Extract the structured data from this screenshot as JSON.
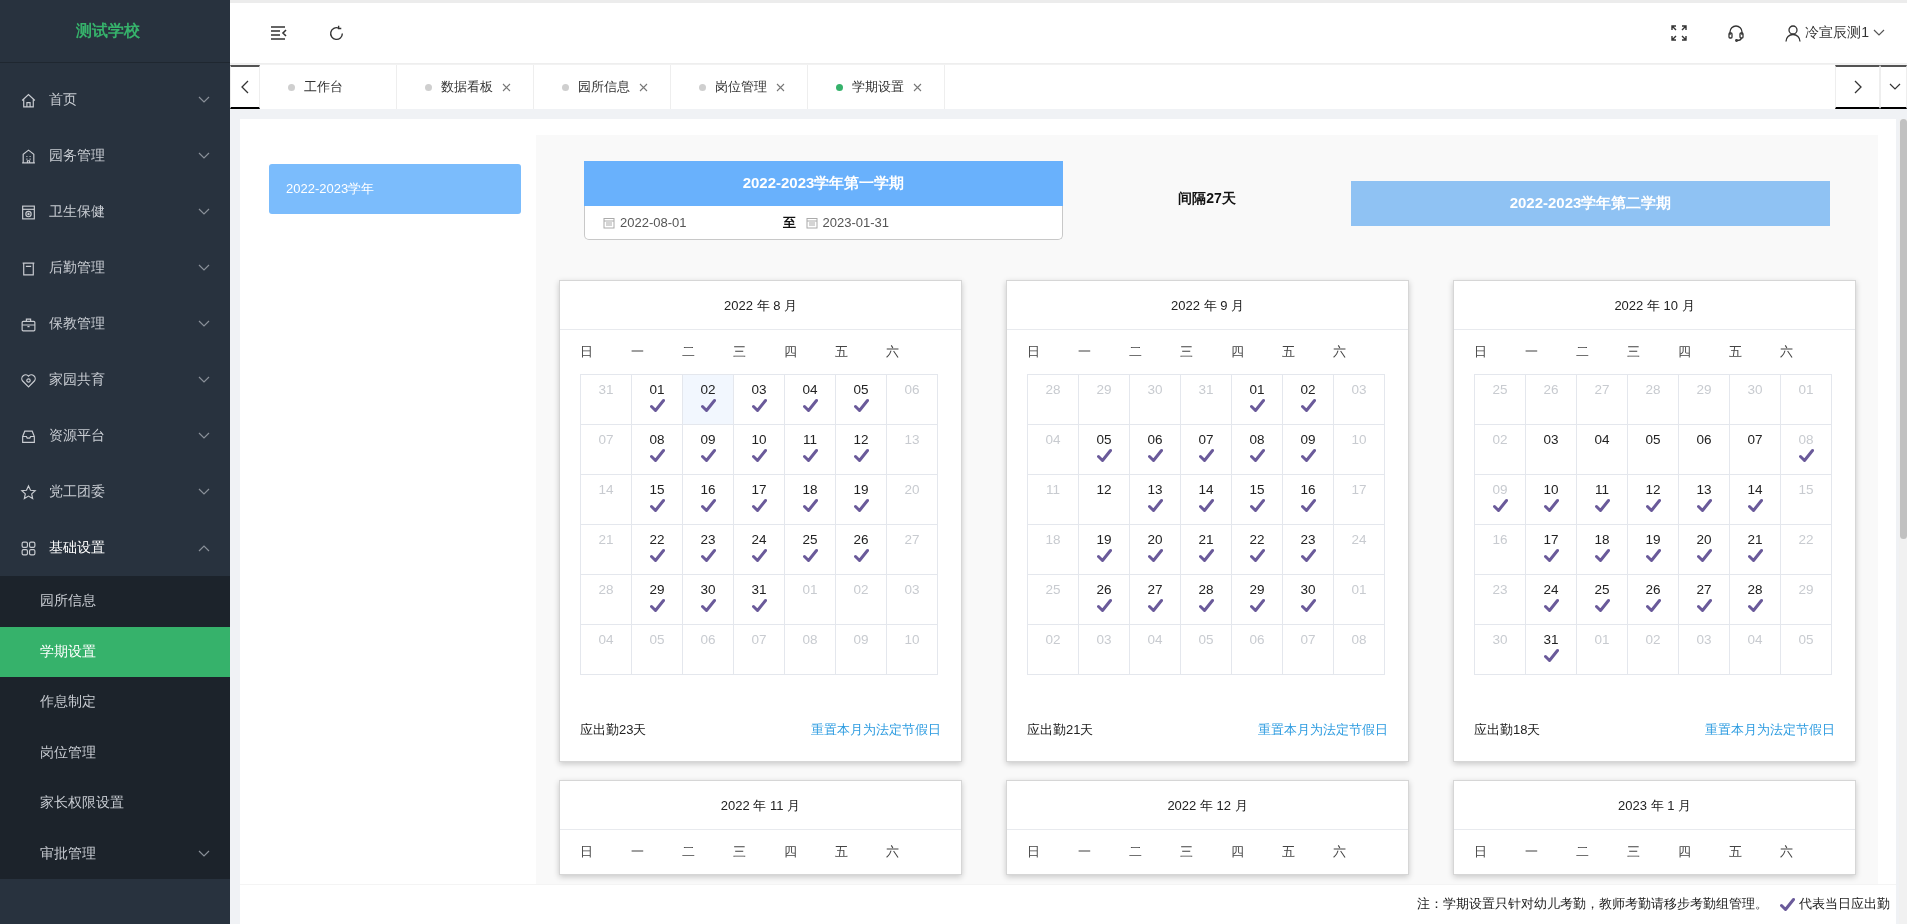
{
  "sidebar": {
    "logo": "测试学校",
    "items": [
      {
        "label": "首页",
        "expanded": false
      },
      {
        "label": "园务管理",
        "expanded": false
      },
      {
        "label": "卫生保健",
        "expanded": false
      },
      {
        "label": "后勤管理",
        "expanded": false
      },
      {
        "label": "保教管理",
        "expanded": false
      },
      {
        "label": "家园共育",
        "expanded": false
      },
      {
        "label": "资源平台",
        "expanded": false
      },
      {
        "label": "党工团委",
        "expanded": false
      },
      {
        "label": "基础设置",
        "expanded": true,
        "children": [
          {
            "label": "园所信息",
            "kind": "item",
            "selected": false
          },
          {
            "label": "学期设置",
            "kind": "item",
            "selected": true
          },
          {
            "label": "作息制定",
            "kind": "item",
            "selected": false
          },
          {
            "label": "岗位管理",
            "kind": "item",
            "selected": false
          },
          {
            "label": "家长权限设置",
            "kind": "item",
            "selected": false
          },
          {
            "label": "审批管理",
            "kind": "submenu",
            "selected": false
          }
        ]
      }
    ]
  },
  "header": {
    "user": "冷宣辰测1"
  },
  "tabs": [
    {
      "label": "工作台",
      "selected": false,
      "closable": false
    },
    {
      "label": "数据看板",
      "selected": false,
      "closable": true
    },
    {
      "label": "园所信息",
      "selected": false,
      "closable": true
    },
    {
      "label": "岗位管理",
      "selected": false,
      "closable": true
    },
    {
      "label": "学期设置",
      "selected": true,
      "closable": true
    }
  ],
  "years": [
    {
      "label": "2022-2023学年",
      "selected": true
    }
  ],
  "terms": [
    {
      "title": "2022-2023学年第一学期",
      "selected": true,
      "start": "2022-08-01",
      "separator": "至",
      "end": "2023-01-31"
    },
    {
      "title": "2022-2023学年第二学期",
      "selected": false
    }
  ],
  "interval": "间隔27天",
  "months": [
    {
      "title": "2022 年 8 月",
      "weekdays": [
        "日",
        "一",
        "二",
        "三",
        "四",
        "五",
        "六"
      ],
      "summary": "应出勤23天",
      "reset_link": "重置本月为法定节假日",
      "weeks": [
        [
          {
            "day": "31",
            "muted": true,
            "checked": false,
            "highlighted": false
          },
          {
            "day": "01",
            "muted": false,
            "checked": true,
            "highlighted": false
          },
          {
            "day": "02",
            "muted": false,
            "checked": true,
            "highlighted": true
          },
          {
            "day": "03",
            "muted": false,
            "checked": true,
            "highlighted": false
          },
          {
            "day": "04",
            "muted": false,
            "checked": true,
            "highlighted": false
          },
          {
            "day": "05",
            "muted": false,
            "checked": true,
            "highlighted": false
          },
          {
            "day": "06",
            "muted": true,
            "checked": false,
            "highlighted": false
          }
        ],
        [
          {
            "day": "07",
            "muted": true,
            "checked": false,
            "highlighted": false
          },
          {
            "day": "08",
            "muted": false,
            "checked": true,
            "highlighted": false
          },
          {
            "day": "09",
            "muted": false,
            "checked": true,
            "highlighted": false
          },
          {
            "day": "10",
            "muted": false,
            "checked": true,
            "highlighted": false
          },
          {
            "day": "11",
            "muted": false,
            "checked": true,
            "highlighted": false
          },
          {
            "day": "12",
            "muted": false,
            "checked": true,
            "highlighted": false
          },
          {
            "day": "13",
            "muted": true,
            "checked": false,
            "highlighted": false
          }
        ],
        [
          {
            "day": "14",
            "muted": true,
            "checked": false,
            "highlighted": false
          },
          {
            "day": "15",
            "muted": false,
            "checked": true,
            "highlighted": false
          },
          {
            "day": "16",
            "muted": false,
            "checked": true,
            "highlighted": false
          },
          {
            "day": "17",
            "muted": false,
            "checked": true,
            "highlighted": false
          },
          {
            "day": "18",
            "muted": false,
            "checked": true,
            "highlighted": false
          },
          {
            "day": "19",
            "muted": false,
            "checked": true,
            "highlighted": false
          },
          {
            "day": "20",
            "muted": true,
            "checked": false,
            "highlighted": false
          }
        ],
        [
          {
            "day": "21",
            "muted": true,
            "checked": false,
            "highlighted": false
          },
          {
            "day": "22",
            "muted": false,
            "checked": true,
            "highlighted": false
          },
          {
            "day": "23",
            "muted": false,
            "checked": true,
            "highlighted": false
          },
          {
            "day": "24",
            "muted": false,
            "checked": true,
            "highlighted": false
          },
          {
            "day": "25",
            "muted": false,
            "checked": true,
            "highlighted": false
          },
          {
            "day": "26",
            "muted": false,
            "checked": true,
            "highlighted": false
          },
          {
            "day": "27",
            "muted": true,
            "checked": false,
            "highlighted": false
          }
        ],
        [
          {
            "day": "28",
            "muted": true,
            "checked": false,
            "highlighted": false
          },
          {
            "day": "29",
            "muted": false,
            "checked": true,
            "highlighted": false
          },
          {
            "day": "30",
            "muted": false,
            "checked": true,
            "highlighted": false
          },
          {
            "day": "31",
            "muted": false,
            "checked": true,
            "highlighted": false
          },
          {
            "day": "01",
            "muted": true,
            "checked": false,
            "highlighted": false
          },
          {
            "day": "02",
            "muted": true,
            "checked": false,
            "highlighted": false
          },
          {
            "day": "03",
            "muted": true,
            "checked": false,
            "highlighted": false
          }
        ],
        [
          {
            "day": "04",
            "muted": true,
            "checked": false,
            "highlighted": false
          },
          {
            "day": "05",
            "muted": true,
            "checked": false,
            "highlighted": false
          },
          {
            "day": "06",
            "muted": true,
            "checked": false,
            "highlighted": false
          },
          {
            "day": "07",
            "muted": true,
            "checked": false,
            "highlighted": false
          },
          {
            "day": "08",
            "muted": true,
            "checked": false,
            "highlighted": false
          },
          {
            "day": "09",
            "muted": true,
            "checked": false,
            "highlighted": false
          },
          {
            "day": "10",
            "muted": true,
            "checked": false,
            "highlighted": false
          }
        ]
      ]
    },
    {
      "title": "2022 年 9 月",
      "weekdays": [
        "日",
        "一",
        "二",
        "三",
        "四",
        "五",
        "六"
      ],
      "summary": "应出勤21天",
      "reset_link": "重置本月为法定节假日",
      "weeks": [
        [
          {
            "day": "28",
            "muted": true,
            "checked": false,
            "highlighted": false
          },
          {
            "day": "29",
            "muted": true,
            "checked": false,
            "highlighted": false
          },
          {
            "day": "30",
            "muted": true,
            "checked": false,
            "highlighted": false
          },
          {
            "day": "31",
            "muted": true,
            "checked": false,
            "highlighted": false
          },
          {
            "day": "01",
            "muted": false,
            "checked": true,
            "highlighted": false
          },
          {
            "day": "02",
            "muted": false,
            "checked": true,
            "highlighted": false
          },
          {
            "day": "03",
            "muted": true,
            "checked": false,
            "highlighted": false
          }
        ],
        [
          {
            "day": "04",
            "muted": true,
            "checked": false,
            "highlighted": false
          },
          {
            "day": "05",
            "muted": false,
            "checked": true,
            "highlighted": false
          },
          {
            "day": "06",
            "muted": false,
            "checked": true,
            "highlighted": false
          },
          {
            "day": "07",
            "muted": false,
            "checked": true,
            "highlighted": false
          },
          {
            "day": "08",
            "muted": false,
            "checked": true,
            "highlighted": false
          },
          {
            "day": "09",
            "muted": false,
            "checked": true,
            "highlighted": false
          },
          {
            "day": "10",
            "muted": true,
            "checked": false,
            "highlighted": false
          }
        ],
        [
          {
            "day": "11",
            "muted": true,
            "checked": false,
            "highlighted": false
          },
          {
            "day": "12",
            "muted": false,
            "checked": false,
            "highlighted": false
          },
          {
            "day": "13",
            "muted": false,
            "checked": true,
            "highlighted": false
          },
          {
            "day": "14",
            "muted": false,
            "checked": true,
            "highlighted": false
          },
          {
            "day": "15",
            "muted": false,
            "checked": true,
            "highlighted": false
          },
          {
            "day": "16",
            "muted": false,
            "checked": true,
            "highlighted": false
          },
          {
            "day": "17",
            "muted": true,
            "checked": false,
            "highlighted": false
          }
        ],
        [
          {
            "day": "18",
            "muted": true,
            "checked": false,
            "highlighted": false
          },
          {
            "day": "19",
            "muted": false,
            "checked": true,
            "highlighted": false
          },
          {
            "day": "20",
            "muted": false,
            "checked": true,
            "highlighted": false
          },
          {
            "day": "21",
            "muted": false,
            "checked": true,
            "highlighted": false
          },
          {
            "day": "22",
            "muted": false,
            "checked": true,
            "highlighted": false
          },
          {
            "day": "23",
            "muted": false,
            "checked": true,
            "highlighted": false
          },
          {
            "day": "24",
            "muted": true,
            "checked": false,
            "highlighted": false
          }
        ],
        [
          {
            "day": "25",
            "muted": true,
            "checked": false,
            "highlighted": false
          },
          {
            "day": "26",
            "muted": false,
            "checked": true,
            "highlighted": false
          },
          {
            "day": "27",
            "muted": false,
            "checked": true,
            "highlighted": false
          },
          {
            "day": "28",
            "muted": false,
            "checked": true,
            "highlighted": false
          },
          {
            "day": "29",
            "muted": false,
            "checked": true,
            "highlighted": false
          },
          {
            "day": "30",
            "muted": false,
            "checked": true,
            "highlighted": false
          },
          {
            "day": "01",
            "muted": true,
            "checked": false,
            "highlighted": false
          }
        ],
        [
          {
            "day": "02",
            "muted": true,
            "checked": false,
            "highlighted": false
          },
          {
            "day": "03",
            "muted": true,
            "checked": false,
            "highlighted": false
          },
          {
            "day": "04",
            "muted": true,
            "checked": false,
            "highlighted": false
          },
          {
            "day": "05",
            "muted": true,
            "checked": false,
            "highlighted": false
          },
          {
            "day": "06",
            "muted": true,
            "checked": false,
            "highlighted": false
          },
          {
            "day": "07",
            "muted": true,
            "checked": false,
            "highlighted": false
          },
          {
            "day": "08",
            "muted": true,
            "checked": false,
            "highlighted": false
          }
        ]
      ]
    },
    {
      "title": "2022 年 10 月",
      "weekdays": [
        "日",
        "一",
        "二",
        "三",
        "四",
        "五",
        "六"
      ],
      "summary": "应出勤18天",
      "reset_link": "重置本月为法定节假日",
      "weeks": [
        [
          {
            "day": "25",
            "muted": true,
            "checked": false,
            "highlighted": false
          },
          {
            "day": "26",
            "muted": true,
            "checked": false,
            "highlighted": false
          },
          {
            "day": "27",
            "muted": true,
            "checked": false,
            "highlighted": false
          },
          {
            "day": "28",
            "muted": true,
            "checked": false,
            "highlighted": false
          },
          {
            "day": "29",
            "muted": true,
            "checked": false,
            "highlighted": false
          },
          {
            "day": "30",
            "muted": true,
            "checked": false,
            "highlighted": false
          },
          {
            "day": "01",
            "muted": true,
            "checked": false,
            "highlighted": false
          }
        ],
        [
          {
            "day": "02",
            "muted": true,
            "checked": false,
            "highlighted": false
          },
          {
            "day": "03",
            "muted": false,
            "checked": false,
            "highlighted": false
          },
          {
            "day": "04",
            "muted": false,
            "checked": false,
            "highlighted": false
          },
          {
            "day": "05",
            "muted": false,
            "checked": false,
            "highlighted": false
          },
          {
            "day": "06",
            "muted": false,
            "checked": false,
            "highlighted": false
          },
          {
            "day": "07",
            "muted": false,
            "checked": false,
            "highlighted": false
          },
          {
            "day": "08",
            "muted": true,
            "checked": true,
            "highlighted": false
          }
        ],
        [
          {
            "day": "09",
            "muted": true,
            "checked": true,
            "highlighted": false
          },
          {
            "day": "10",
            "muted": false,
            "checked": true,
            "highlighted": false
          },
          {
            "day": "11",
            "muted": false,
            "checked": true,
            "highlighted": false
          },
          {
            "day": "12",
            "muted": false,
            "checked": true,
            "highlighted": false
          },
          {
            "day": "13",
            "muted": false,
            "checked": true,
            "highlighted": false
          },
          {
            "day": "14",
            "muted": false,
            "checked": true,
            "highlighted": false
          },
          {
            "day": "15",
            "muted": true,
            "checked": false,
            "highlighted": false
          }
        ],
        [
          {
            "day": "16",
            "muted": true,
            "checked": false,
            "highlighted": false
          },
          {
            "day": "17",
            "muted": false,
            "checked": true,
            "highlighted": false
          },
          {
            "day": "18",
            "muted": false,
            "checked": true,
            "highlighted": false
          },
          {
            "day": "19",
            "muted": false,
            "checked": true,
            "highlighted": false
          },
          {
            "day": "20",
            "muted": false,
            "checked": true,
            "highlighted": false
          },
          {
            "day": "21",
            "muted": false,
            "checked": true,
            "highlighted": false
          },
          {
            "day": "22",
            "muted": true,
            "checked": false,
            "highlighted": false
          }
        ],
        [
          {
            "day": "23",
            "muted": true,
            "checked": false,
            "highlighted": false
          },
          {
            "day": "24",
            "muted": false,
            "checked": true,
            "highlighted": false
          },
          {
            "day": "25",
            "muted": false,
            "checked": true,
            "highlighted": false
          },
          {
            "day": "26",
            "muted": false,
            "checked": true,
            "highlighted": false
          },
          {
            "day": "27",
            "muted": false,
            "checked": true,
            "highlighted": false
          },
          {
            "day": "28",
            "muted": false,
            "checked": true,
            "highlighted": false
          },
          {
            "day": "29",
            "muted": true,
            "checked": false,
            "highlighted": false
          }
        ],
        [
          {
            "day": "30",
            "muted": true,
            "checked": false,
            "highlighted": false
          },
          {
            "day": "31",
            "muted": false,
            "checked": true,
            "highlighted": false
          },
          {
            "day": "01",
            "muted": true,
            "checked": false,
            "highlighted": false
          },
          {
            "day": "02",
            "muted": true,
            "checked": false,
            "highlighted": false
          },
          {
            "day": "03",
            "muted": true,
            "checked": false,
            "highlighted": false
          },
          {
            "day": "04",
            "muted": true,
            "checked": false,
            "highlighted": false
          },
          {
            "day": "05",
            "muted": true,
            "checked": false,
            "highlighted": false
          }
        ]
      ]
    },
    {
      "title": "2022 年 11 月",
      "weekdays": [
        "日",
        "一",
        "二",
        "三",
        "四",
        "五",
        "六"
      ]
    },
    {
      "title": "2022 年 12 月",
      "weekdays": [
        "日",
        "一",
        "二",
        "三",
        "四",
        "五",
        "六"
      ]
    },
    {
      "title": "2023 年 1 月",
      "weekdays": [
        "日",
        "一",
        "二",
        "三",
        "四",
        "五",
        "六"
      ]
    }
  ],
  "note": {
    "text": "注：学期设置只针对幼儿考勤，教师考勤请移步考勤组管理。",
    "legend": "代表当日应出勤"
  }
}
